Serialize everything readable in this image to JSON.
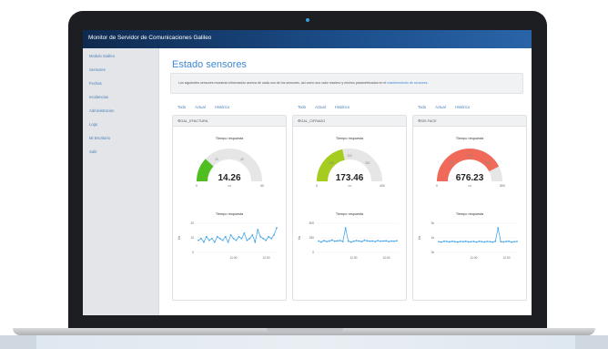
{
  "app": {
    "title": "Monitor de Servidor de Comunicaciones Galileo",
    "accent": "#1c4f8c",
    "link_color": "#3f8ad2"
  },
  "sidebar": {
    "items": [
      {
        "label": "Modulo Galileo"
      },
      {
        "label": "Sensores"
      },
      {
        "label": "Fechas"
      },
      {
        "label": "Incidencias"
      },
      {
        "label": "Administracion"
      },
      {
        "label": "Logs"
      },
      {
        "label": "Mi Escritorio"
      },
      {
        "label": "Salir"
      }
    ]
  },
  "main": {
    "page_title": "Estado sensores",
    "info_text": "Los siguientes sensores muestran información acerca de cada uno de los sensores, así como sus valor maximo y minimo parametrizados en el",
    "info_link": "mantenimiento de sensores."
  },
  "tabs": [
    "Todo",
    "Actual",
    "Histórico"
  ],
  "cards": [
    {
      "name": "GAL_EFACTURA",
      "gauge": {
        "title": "Tiempo respuesta",
        "value": "14.26",
        "unit": "ms",
        "min": "0",
        "max": "60",
        "ticks": [
          "20",
          "40"
        ],
        "fill_fraction": 0.24,
        "color": "#4fbf1f"
      },
      "chart": {
        "title": "Tiempo respuesta",
        "ylabel": "Ms",
        "yticks": [
          "20",
          "10",
          "0"
        ],
        "xticks": [
          "11:00",
          "12:00"
        ],
        "color": "#4aa8e8",
        "values": [
          10,
          11,
          9,
          12,
          10,
          11,
          9,
          12,
          11,
          10,
          12,
          9,
          13,
          11,
          10,
          12,
          11,
          14,
          10,
          11,
          13,
          9,
          16,
          12,
          11,
          10,
          12,
          11,
          13,
          17
        ]
      }
    },
    {
      "name": "GAL_CIFRADO",
      "gauge": {
        "title": "Tiempo respuesta",
        "value": "173.46",
        "unit": "ms",
        "min": "0",
        "max": "400",
        "ticks": [
          "100",
          "200",
          "300"
        ],
        "fill_fraction": 0.43,
        "color": "#a6cc1f"
      },
      "chart": {
        "title": "Tiempo respuesta",
        "ylabel": "Ms",
        "yticks": [
          "500",
          "250",
          "0"
        ],
        "xticks": [
          "11:00",
          "12:00"
        ],
        "color": "#4aa8e8",
        "values": [
          170,
          160,
          175,
          165,
          170,
          180,
          168,
          172,
          175,
          165,
          300,
          170,
          160,
          168,
          175,
          170,
          165,
          178,
          172,
          168,
          170,
          165,
          175,
          168,
          170,
          172,
          165,
          170,
          168,
          173
        ]
      }
    },
    {
      "name": "SIS FACE",
      "gauge": {
        "title": "Tiempo respuesta",
        "value": "676.23",
        "unit": "ms",
        "min": "0",
        "max": "800",
        "ticks": [
          "200",
          "400",
          "600"
        ],
        "fill_fraction": 0.85,
        "color": "#f06a5a"
      },
      "chart": {
        "title": "Tiempo respuesta",
        "ylabel": "Ms",
        "yticks": [
          "2k",
          "1k",
          "0k"
        ],
        "xticks": [
          "11:00",
          "12:00"
        ],
        "color": "#4aa8e8",
        "values": [
          650,
          640,
          660,
          655,
          645,
          660,
          650,
          640,
          655,
          650,
          660,
          645,
          650,
          655,
          640,
          660,
          650,
          645,
          655,
          650,
          640,
          660,
          1000,
          650,
          645,
          655,
          660,
          640,
          650,
          655
        ]
      }
    }
  ]
}
